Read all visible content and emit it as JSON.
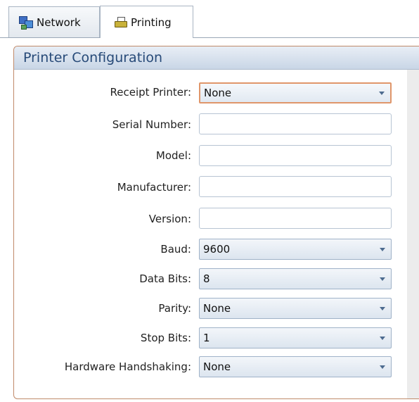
{
  "tabs": [
    {
      "label": "Network",
      "icon": "network-icon",
      "active": false
    },
    {
      "label": "Printing",
      "icon": "printer-icon",
      "active": true
    }
  ],
  "panel": {
    "title": "Printer Configuration"
  },
  "form": {
    "receipt_printer": {
      "label": "Receipt Printer:",
      "value": "None"
    },
    "serial_number": {
      "label": "Serial Number:",
      "value": ""
    },
    "model": {
      "label": "Model:",
      "value": ""
    },
    "manufacturer": {
      "label": "Manufacturer:",
      "value": ""
    },
    "version": {
      "label": "Version:",
      "value": ""
    },
    "baud": {
      "label": "Baud:",
      "value": "9600"
    },
    "data_bits": {
      "label": "Data Bits:",
      "value": "8"
    },
    "parity": {
      "label": "Parity:",
      "value": "None"
    },
    "stop_bits": {
      "label": "Stop Bits:",
      "value": "1"
    },
    "hardware_handshaking": {
      "label": "Hardware Handshaking:",
      "value": "None"
    }
  },
  "colors": {
    "panel_border": "#c08a6a",
    "header_title": "#274a78",
    "focus_border": "#e0966a"
  }
}
